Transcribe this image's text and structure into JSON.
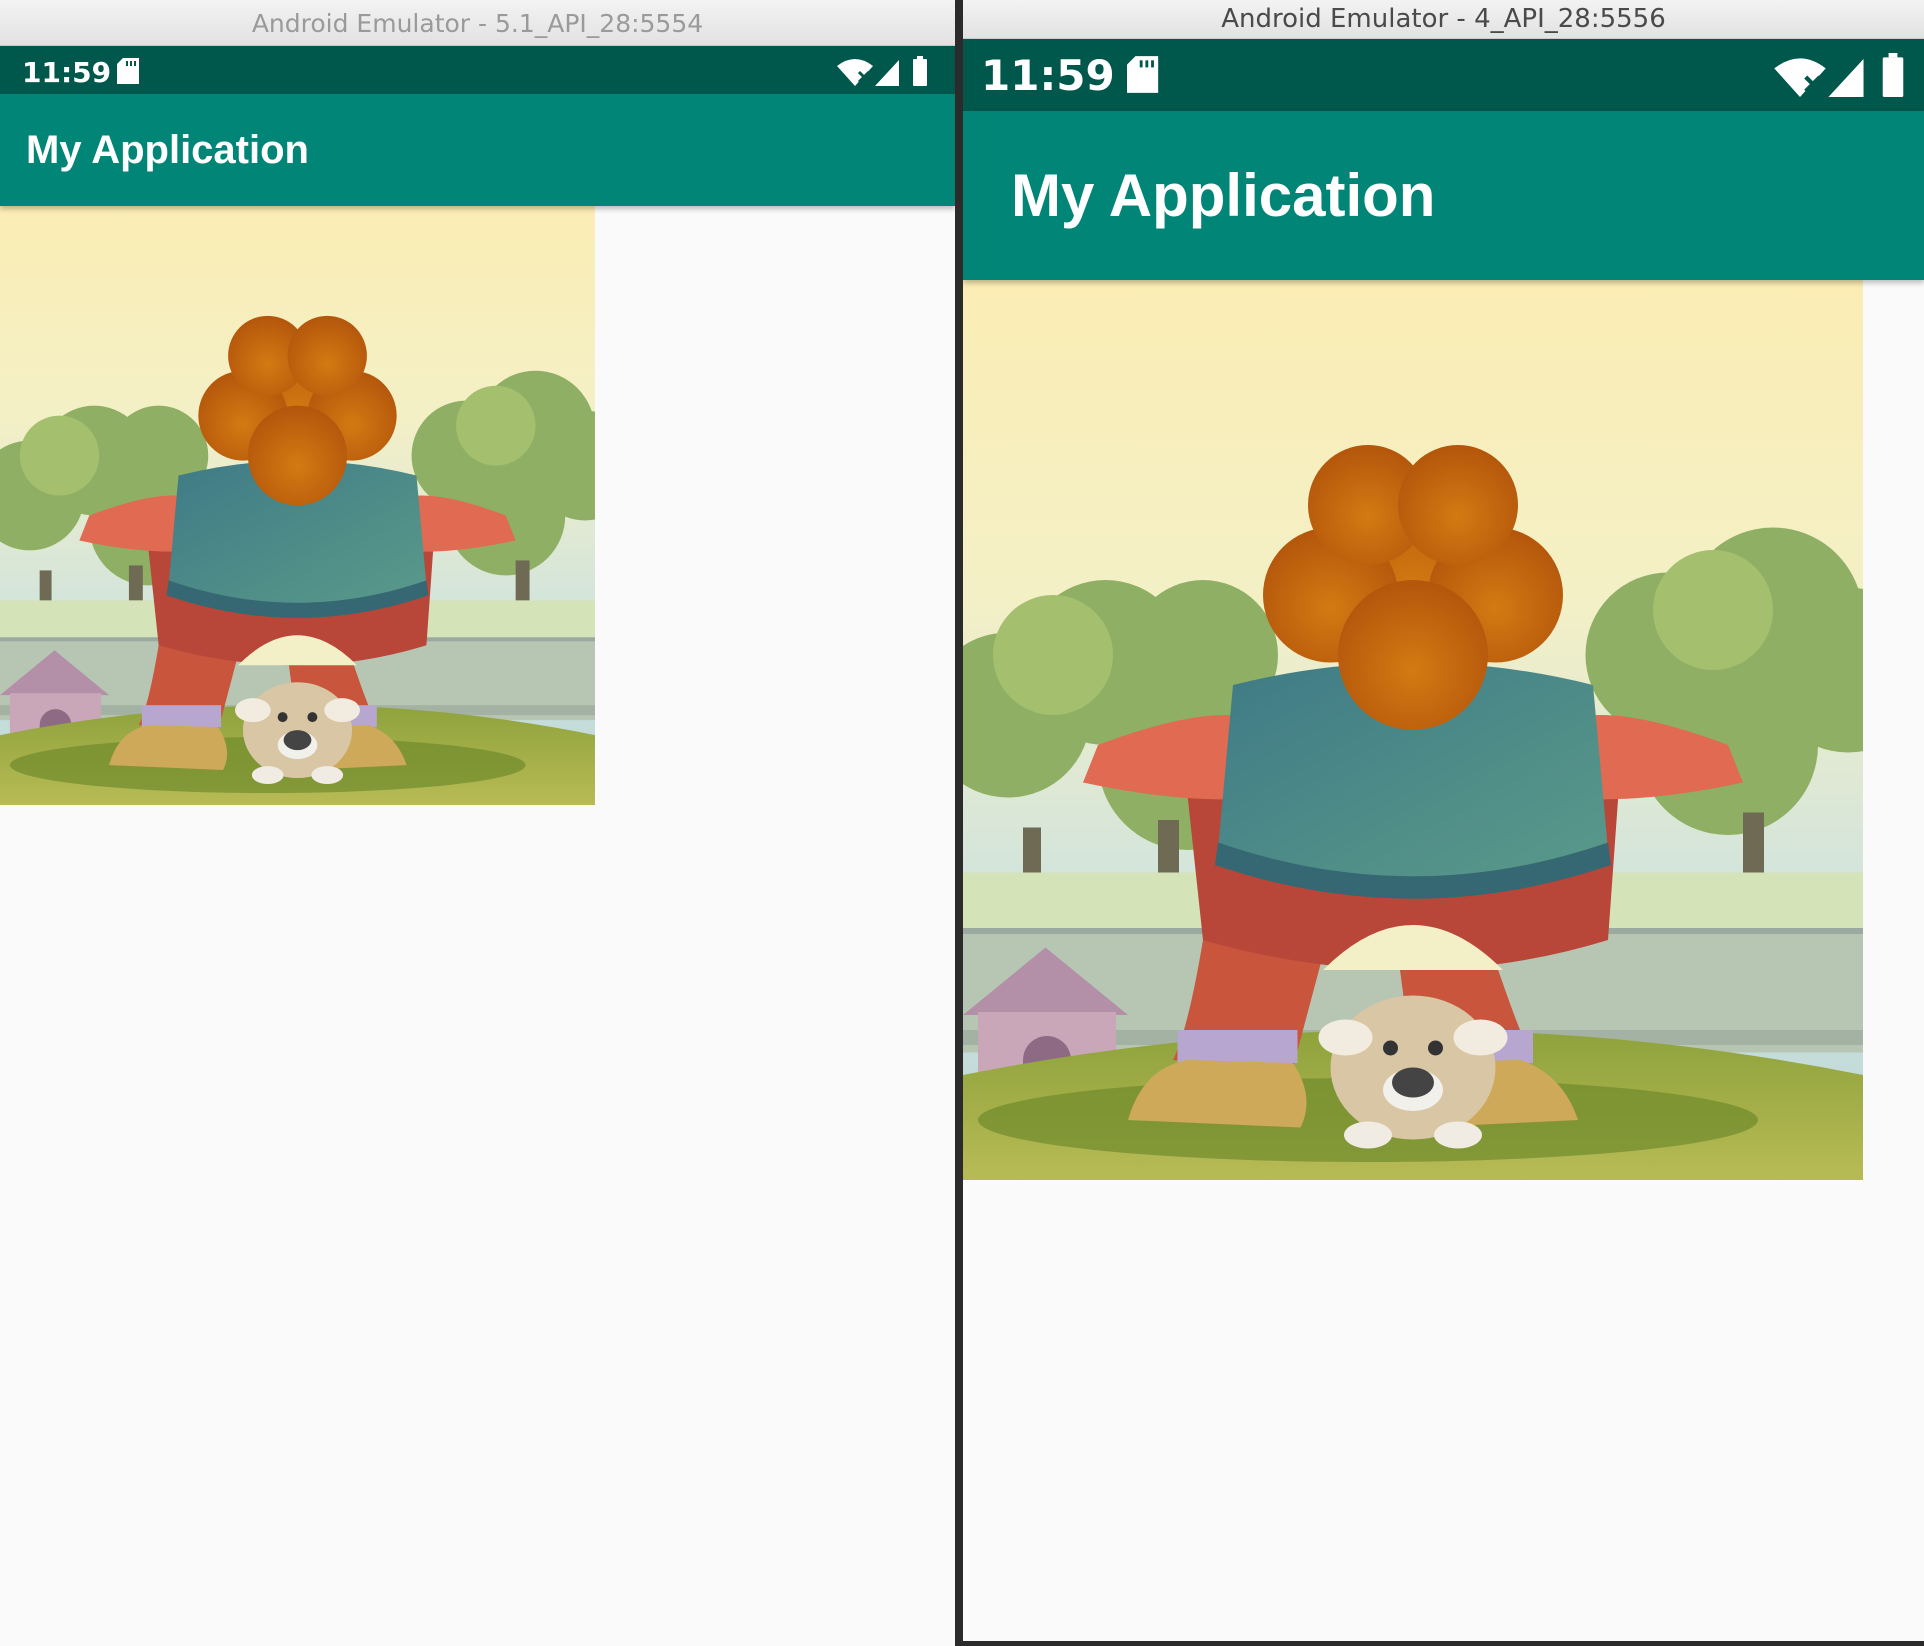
{
  "windows": [
    {
      "title": "Android Emulator - 5.1_API_28:5554",
      "status": {
        "time": "11:59"
      },
      "app_bar": {
        "title": "My Application"
      }
    },
    {
      "title": "Android Emulator - 4_API_28:5556",
      "status": {
        "time": "11:59"
      },
      "app_bar": {
        "title": "My Application"
      }
    }
  ],
  "colors": {
    "status_bar": "#00574b",
    "app_bar": "#008577",
    "content_bg": "#fafafa"
  },
  "icons": {
    "status_left": "sd-card-icon",
    "status_right": [
      "wifi-off-icon",
      "signal-icon",
      "battery-icon"
    ]
  },
  "image_content": "cartoon-boy-and-dog-illustration"
}
